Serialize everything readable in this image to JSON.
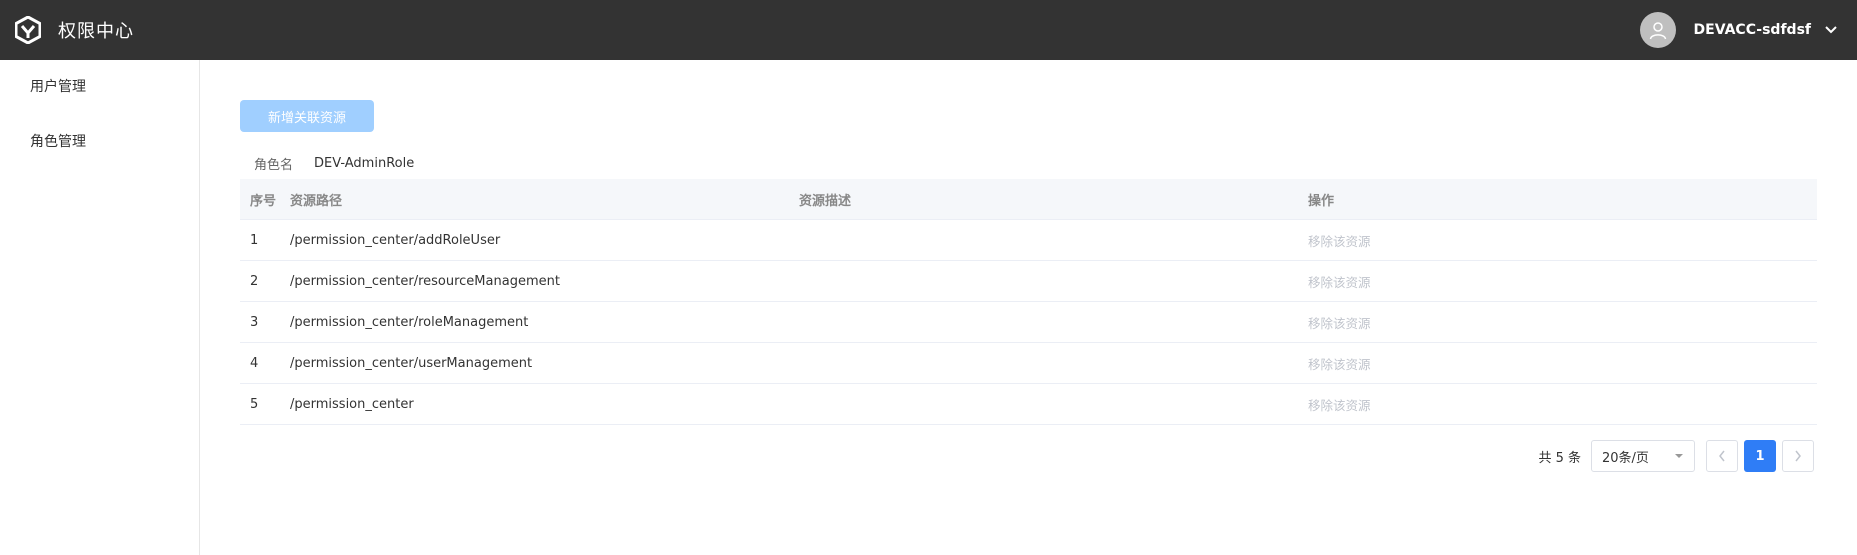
{
  "app": {
    "title": "权限中心"
  },
  "user": {
    "name": "DEVACC-sdfdsf"
  },
  "sidebar": {
    "items": [
      {
        "label": "用户管理"
      },
      {
        "label": "角色管理"
      }
    ]
  },
  "actions": {
    "add_button_label": "新增关联资源"
  },
  "role": {
    "label": "角色名",
    "value": "DEV-AdminRole"
  },
  "table": {
    "headers": {
      "index": "序号",
      "path": "资源路径",
      "description": "资源描述",
      "operation": "操作"
    },
    "rows": [
      {
        "index": "1",
        "path": "/permission_center/addRoleUser",
        "description": "",
        "action": "移除该资源"
      },
      {
        "index": "2",
        "path": "/permission_center/resourceManagement",
        "description": "",
        "action": "移除该资源"
      },
      {
        "index": "3",
        "path": "/permission_center/roleManagement",
        "description": "",
        "action": "移除该资源"
      },
      {
        "index": "4",
        "path": "/permission_center/userManagement",
        "description": "",
        "action": "移除该资源"
      },
      {
        "index": "5",
        "path": "/permission_center",
        "description": "",
        "action": "移除该资源"
      }
    ]
  },
  "pagination": {
    "total_label": "共 5 条",
    "page_size": "20条/页",
    "current_page": "1"
  },
  "colors": {
    "header_bg": "#333333",
    "primary": "#2f7df6",
    "button_disabled": "#a0cfff"
  }
}
